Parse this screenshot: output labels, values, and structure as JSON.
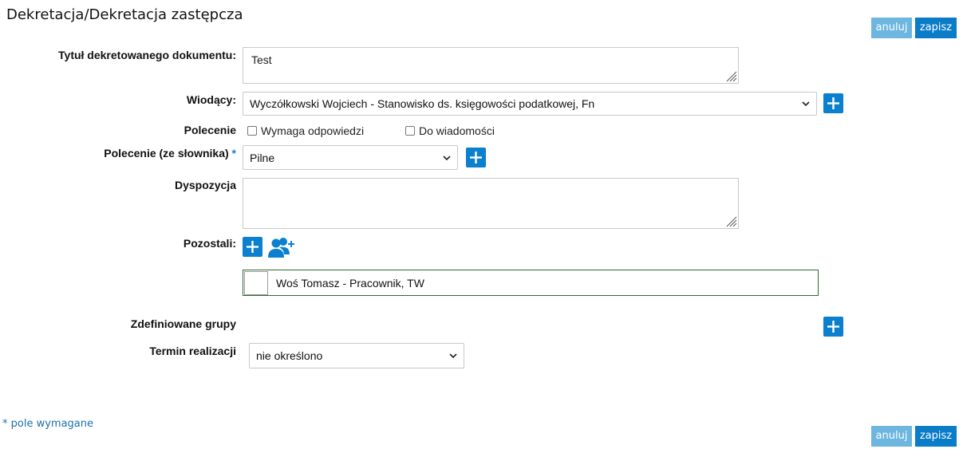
{
  "header": {
    "title": "Dekretacja/Dekretacja zastępcza",
    "cancel_label": "anuluj",
    "save_label": "zapisz"
  },
  "form": {
    "title_label": "Tytuł dekretowanego dokumentu:",
    "title_value": "Test",
    "lead_label": "Wiodący:",
    "lead_value": "Wyczółkowski Wojciech - Stanowisko ds. księgowości podatkowej, Fn",
    "command_label": "Polecenie",
    "requires_response_label": "Wymaga odpowiedzi",
    "for_info_label": "Do wiadomości",
    "dict_command_label": "Polecenie (ze słownika)",
    "required_marker": "*",
    "dict_command_value": "Pilne",
    "disposition_label": "Dyspozycja",
    "disposition_value": "",
    "others_label": "Pozostali:",
    "others": [
      {
        "name": "Woś Tomasz - Pracownik, TW"
      }
    ],
    "groups_label": "Zdefiniowane grupy",
    "deadline_label": "Termin realizacji",
    "deadline_value": "nie określono"
  },
  "footer": {
    "required_note": "* pole wymagane",
    "cancel_label": "anuluj",
    "save_label": "zapisz"
  },
  "colors": {
    "primary": "#0a80cf",
    "cancel": "#6cb6e0",
    "selected_border": "#2e6b2e"
  }
}
